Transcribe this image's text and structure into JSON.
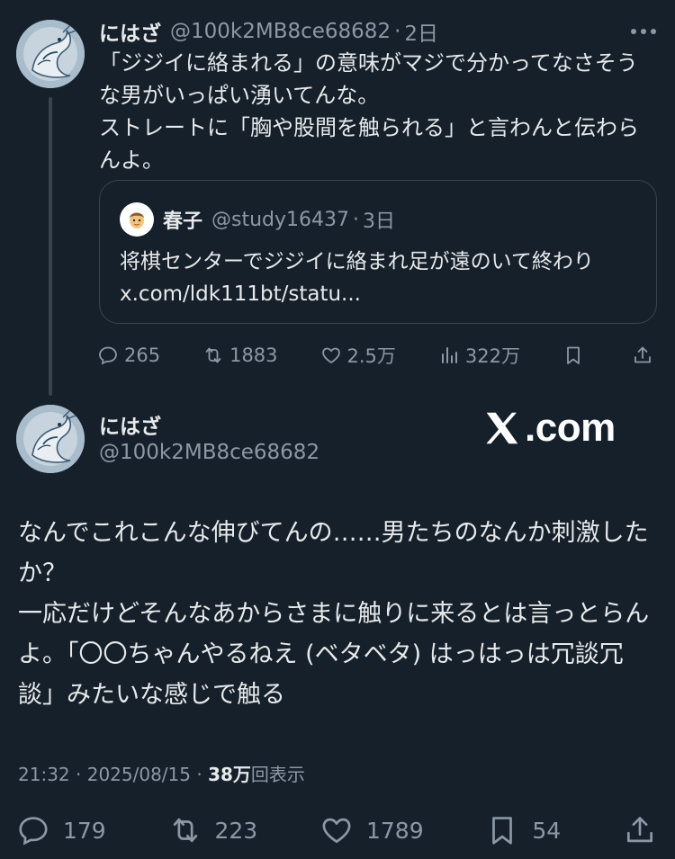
{
  "parent_tweet": {
    "name": "にはざ",
    "handle": "@100k2MB8ce68682",
    "separator": "·",
    "time": "2日",
    "text": "「ジジイに絡まれる」の意味がマジで分かってなさそうな男がいっぱい湧いてんな。\nストレートに「胸や股間を触られる」と言わんと伝わらんよ。",
    "quote": {
      "name": "春子",
      "handle": "@study16437",
      "separator": "·",
      "time": "3日",
      "text": "将棋センターでジジイに絡まれ足が遠のいて終わり",
      "link": "x.com/ldk111bt/statu..."
    },
    "actions": {
      "replies": "265",
      "reposts": "1883",
      "likes": "2.5万",
      "views": "322万"
    }
  },
  "main_tweet": {
    "name": "にはざ",
    "handle": "@100k2MB8ce68682",
    "watermark": ".com",
    "text": "なんでこれこんな伸びてんの……男たちのなんか刺激したか？\n一応だけどそんなあからさまに触りに来るとは言っとらんよ。「〇〇ちゃんやるねえ (ベタベタ) はっはっは冗談冗談」みたいな感じで触る",
    "time": "21:32",
    "separator": "·",
    "date": "2025/08/15",
    "views_count": "38万",
    "views_label": "回表示",
    "actions": {
      "replies": "179",
      "reposts": "223",
      "likes": "1789",
      "bookmarks": "54"
    }
  },
  "colors": {
    "background": "#15202b",
    "text": "#e7e9ea",
    "secondary": "#8b98a5",
    "border": "#38444d"
  }
}
